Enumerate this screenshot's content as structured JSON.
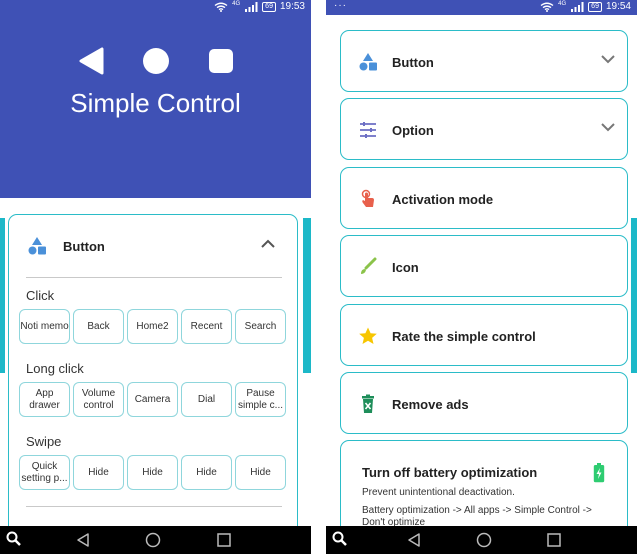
{
  "left": {
    "status": {
      "network": "4G",
      "battery": "69",
      "time": "19:53"
    },
    "header": {
      "title": "Simple Control"
    },
    "button_card": {
      "title": "Button",
      "sections": [
        {
          "label": "Click",
          "buttons": [
            "Noti memo",
            "Back",
            "Home2",
            "Recent",
            "Search"
          ]
        },
        {
          "label": "Long click",
          "buttons": [
            "App drawer",
            "Volume control",
            "Camera",
            "Dial",
            "Pause simple c..."
          ]
        },
        {
          "label": "Swipe",
          "buttons": [
            "Quick setting p...",
            "Hide",
            "Hide",
            "Hide",
            "Hide"
          ]
        }
      ]
    }
  },
  "right": {
    "status": {
      "dots": "···",
      "network": "4G",
      "battery": "69",
      "time": "19:54"
    },
    "menu": [
      {
        "label": "Button",
        "icon": "shapes-icon",
        "color": "#4a90d9"
      },
      {
        "label": "Option",
        "icon": "sliders-icon",
        "color": "#6c6fc4"
      },
      {
        "label": "Activation mode",
        "icon": "touch-icon",
        "color": "#e8604c"
      },
      {
        "label": "Icon",
        "icon": "brush-icon",
        "color": "#8bc34a"
      },
      {
        "label": "Rate the simple control",
        "icon": "star-icon",
        "color": "#f7c600"
      },
      {
        "label": "Remove ads",
        "icon": "trash-icon",
        "color": "#1e8e5a"
      }
    ],
    "battery_card": {
      "title": "Turn off battery optimization",
      "subtitle": "Prevent unintentional deactivation.",
      "description": "Battery optimization -> All apps -> Simple Control -> Don't optimize",
      "icon": "battery-charging-icon",
      "icon_color": "#2ecc71"
    }
  },
  "colors": {
    "primary": "#3f51b5",
    "accent": "#2bbcc8"
  }
}
